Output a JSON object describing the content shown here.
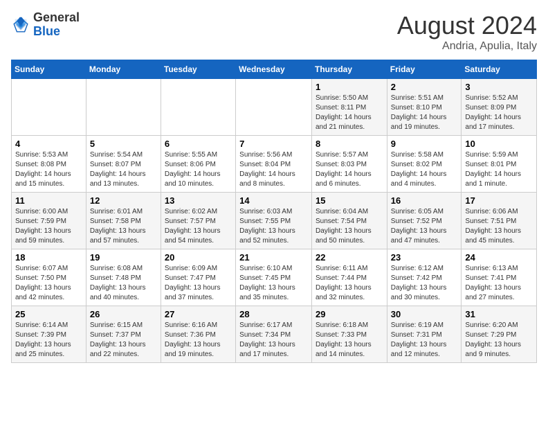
{
  "header": {
    "logo_general": "General",
    "logo_blue": "Blue",
    "month_title": "August 2024",
    "subtitle": "Andria, Apulia, Italy"
  },
  "weekdays": [
    "Sunday",
    "Monday",
    "Tuesday",
    "Wednesday",
    "Thursday",
    "Friday",
    "Saturday"
  ],
  "weeks": [
    [
      {
        "day": "",
        "info": ""
      },
      {
        "day": "",
        "info": ""
      },
      {
        "day": "",
        "info": ""
      },
      {
        "day": "",
        "info": ""
      },
      {
        "day": "1",
        "info": "Sunrise: 5:50 AM\nSunset: 8:11 PM\nDaylight: 14 hours\nand 21 minutes."
      },
      {
        "day": "2",
        "info": "Sunrise: 5:51 AM\nSunset: 8:10 PM\nDaylight: 14 hours\nand 19 minutes."
      },
      {
        "day": "3",
        "info": "Sunrise: 5:52 AM\nSunset: 8:09 PM\nDaylight: 14 hours\nand 17 minutes."
      }
    ],
    [
      {
        "day": "4",
        "info": "Sunrise: 5:53 AM\nSunset: 8:08 PM\nDaylight: 14 hours\nand 15 minutes."
      },
      {
        "day": "5",
        "info": "Sunrise: 5:54 AM\nSunset: 8:07 PM\nDaylight: 14 hours\nand 13 minutes."
      },
      {
        "day": "6",
        "info": "Sunrise: 5:55 AM\nSunset: 8:06 PM\nDaylight: 14 hours\nand 10 minutes."
      },
      {
        "day": "7",
        "info": "Sunrise: 5:56 AM\nSunset: 8:04 PM\nDaylight: 14 hours\nand 8 minutes."
      },
      {
        "day": "8",
        "info": "Sunrise: 5:57 AM\nSunset: 8:03 PM\nDaylight: 14 hours\nand 6 minutes."
      },
      {
        "day": "9",
        "info": "Sunrise: 5:58 AM\nSunset: 8:02 PM\nDaylight: 14 hours\nand 4 minutes."
      },
      {
        "day": "10",
        "info": "Sunrise: 5:59 AM\nSunset: 8:01 PM\nDaylight: 14 hours\nand 1 minute."
      }
    ],
    [
      {
        "day": "11",
        "info": "Sunrise: 6:00 AM\nSunset: 7:59 PM\nDaylight: 13 hours\nand 59 minutes."
      },
      {
        "day": "12",
        "info": "Sunrise: 6:01 AM\nSunset: 7:58 PM\nDaylight: 13 hours\nand 57 minutes."
      },
      {
        "day": "13",
        "info": "Sunrise: 6:02 AM\nSunset: 7:57 PM\nDaylight: 13 hours\nand 54 minutes."
      },
      {
        "day": "14",
        "info": "Sunrise: 6:03 AM\nSunset: 7:55 PM\nDaylight: 13 hours\nand 52 minutes."
      },
      {
        "day": "15",
        "info": "Sunrise: 6:04 AM\nSunset: 7:54 PM\nDaylight: 13 hours\nand 50 minutes."
      },
      {
        "day": "16",
        "info": "Sunrise: 6:05 AM\nSunset: 7:52 PM\nDaylight: 13 hours\nand 47 minutes."
      },
      {
        "day": "17",
        "info": "Sunrise: 6:06 AM\nSunset: 7:51 PM\nDaylight: 13 hours\nand 45 minutes."
      }
    ],
    [
      {
        "day": "18",
        "info": "Sunrise: 6:07 AM\nSunset: 7:50 PM\nDaylight: 13 hours\nand 42 minutes."
      },
      {
        "day": "19",
        "info": "Sunrise: 6:08 AM\nSunset: 7:48 PM\nDaylight: 13 hours\nand 40 minutes."
      },
      {
        "day": "20",
        "info": "Sunrise: 6:09 AM\nSunset: 7:47 PM\nDaylight: 13 hours\nand 37 minutes."
      },
      {
        "day": "21",
        "info": "Sunrise: 6:10 AM\nSunset: 7:45 PM\nDaylight: 13 hours\nand 35 minutes."
      },
      {
        "day": "22",
        "info": "Sunrise: 6:11 AM\nSunset: 7:44 PM\nDaylight: 13 hours\nand 32 minutes."
      },
      {
        "day": "23",
        "info": "Sunrise: 6:12 AM\nSunset: 7:42 PM\nDaylight: 13 hours\nand 30 minutes."
      },
      {
        "day": "24",
        "info": "Sunrise: 6:13 AM\nSunset: 7:41 PM\nDaylight: 13 hours\nand 27 minutes."
      }
    ],
    [
      {
        "day": "25",
        "info": "Sunrise: 6:14 AM\nSunset: 7:39 PM\nDaylight: 13 hours\nand 25 minutes."
      },
      {
        "day": "26",
        "info": "Sunrise: 6:15 AM\nSunset: 7:37 PM\nDaylight: 13 hours\nand 22 minutes."
      },
      {
        "day": "27",
        "info": "Sunrise: 6:16 AM\nSunset: 7:36 PM\nDaylight: 13 hours\nand 19 minutes."
      },
      {
        "day": "28",
        "info": "Sunrise: 6:17 AM\nSunset: 7:34 PM\nDaylight: 13 hours\nand 17 minutes."
      },
      {
        "day": "29",
        "info": "Sunrise: 6:18 AM\nSunset: 7:33 PM\nDaylight: 13 hours\nand 14 minutes."
      },
      {
        "day": "30",
        "info": "Sunrise: 6:19 AM\nSunset: 7:31 PM\nDaylight: 13 hours\nand 12 minutes."
      },
      {
        "day": "31",
        "info": "Sunrise: 6:20 AM\nSunset: 7:29 PM\nDaylight: 13 hours\nand 9 minutes."
      }
    ]
  ]
}
